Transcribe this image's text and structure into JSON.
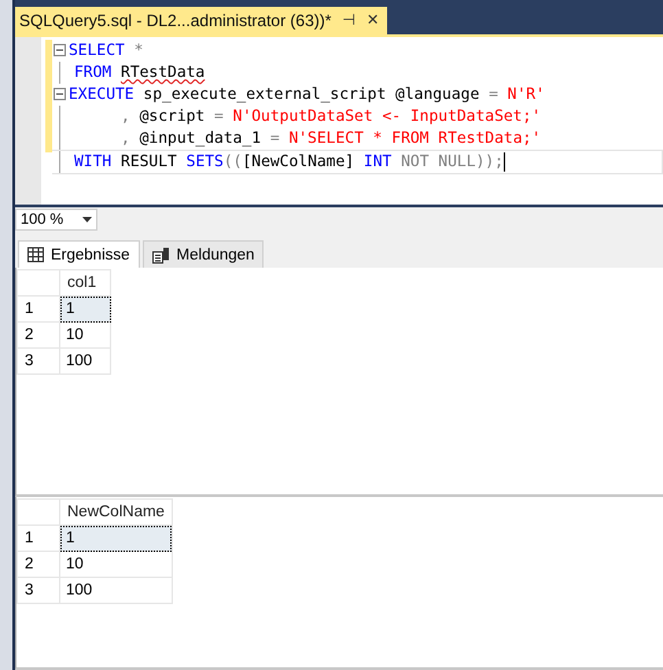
{
  "document_tab": {
    "title": "SQLQuery5.sql - DL2...administrator (63))*",
    "pin": "⊣",
    "close": "✕"
  },
  "editor": {
    "lines": [
      {
        "fold": true,
        "cursor": false,
        "tokens": [
          {
            "kind": "keyword",
            "text": "SELECT"
          },
          {
            "kind": "operator",
            "text": " *"
          }
        ]
      },
      {
        "fold": false,
        "cursor": false,
        "tokens": [
          {
            "kind": "keyword",
            "text": "FROM "
          },
          {
            "kind": "error",
            "text": "RTestData"
          }
        ]
      },
      {
        "fold": true,
        "cursor": false,
        "tokens": [
          {
            "kind": "keyword",
            "text": "EXECUTE"
          },
          {
            "kind": "plain",
            "text": " sp_execute_external_script @language "
          },
          {
            "kind": "operator",
            "text": "="
          },
          {
            "kind": "string",
            "text": " N'R'"
          }
        ]
      },
      {
        "fold": false,
        "cursor": false,
        "tokens": [
          {
            "kind": "operator",
            "text": "     ,"
          },
          {
            "kind": "plain",
            "text": " @script "
          },
          {
            "kind": "operator",
            "text": "="
          },
          {
            "kind": "string",
            "text": " N'OutputDataSet <- InputDataSet;'"
          }
        ]
      },
      {
        "fold": false,
        "cursor": false,
        "tokens": [
          {
            "kind": "operator",
            "text": "     ,"
          },
          {
            "kind": "plain",
            "text": " @input_data_1 "
          },
          {
            "kind": "operator",
            "text": "="
          },
          {
            "kind": "string",
            "text": " N'SELECT * FROM RTestData;'"
          }
        ]
      },
      {
        "fold": false,
        "cursor": true,
        "tokens": [
          {
            "kind": "keyword",
            "text": "WITH"
          },
          {
            "kind": "plain",
            "text": " RESULT "
          },
          {
            "kind": "keyword",
            "text": "SETS"
          },
          {
            "kind": "operator",
            "text": "(("
          },
          {
            "kind": "plain",
            "text": "[NewColName] "
          },
          {
            "kind": "keyword",
            "text": "INT"
          },
          {
            "kind": "operator",
            "text": " NOT NULL));"
          }
        ]
      }
    ]
  },
  "zoom": {
    "value": "100 %"
  },
  "result_tabs": [
    {
      "label": "Ergebnisse",
      "kind": "grid",
      "selected": true
    },
    {
      "label": "Meldungen",
      "kind": "messages",
      "selected": false
    }
  ],
  "grids": [
    {
      "columns": [
        "col1"
      ],
      "rows": [
        {
          "number": "1",
          "cells": [
            "1"
          ],
          "selected": true
        },
        {
          "number": "2",
          "cells": [
            "10"
          ],
          "selected": false
        },
        {
          "number": "3",
          "cells": [
            "100"
          ],
          "selected": false
        }
      ]
    },
    {
      "columns": [
        "NewColName"
      ],
      "rows": [
        {
          "number": "1",
          "cells": [
            "1"
          ],
          "selected": true
        },
        {
          "number": "2",
          "cells": [
            "10"
          ],
          "selected": false
        },
        {
          "number": "3",
          "cells": [
            "100"
          ],
          "selected": false
        }
      ]
    }
  ]
}
